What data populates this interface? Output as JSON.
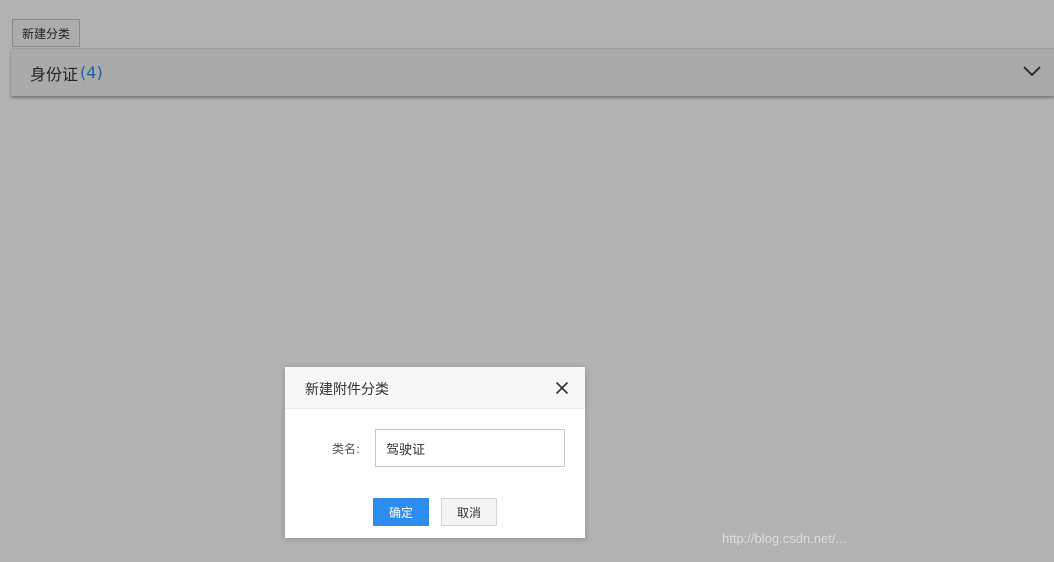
{
  "toolbar": {
    "new_category_label": "新建分类"
  },
  "categories": [
    {
      "name": "身份证",
      "count": "(4)"
    }
  ],
  "modal": {
    "title": "新建附件分类",
    "field_label": "类名:",
    "field_value": "驾驶证",
    "confirm_label": "确定",
    "cancel_label": "取消"
  },
  "watermark": {
    "text": "http://blog.csdn.net/..."
  },
  "colors": {
    "accent": "#2d8cf0",
    "overlay": "rgba(0,0,0,0.30)"
  }
}
